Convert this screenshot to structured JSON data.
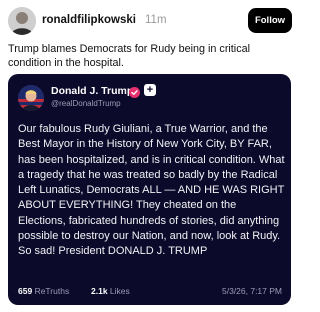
{
  "post": {
    "username": "ronaldfilipkowski",
    "time_ago": "11m",
    "follow_label": "Follow",
    "text": "Trump blames Democrats for Rudy being in critical condition in the hospital."
  },
  "embed": {
    "name": "Donald J. Trump",
    "handle": "@realDonaldTrump",
    "body": "Our fabulous Rudy Giuliani, a True Warrior, and the Best Mayor in the History of New York City, BY FAR, has been hospitalized, and is in critical condition. What a tragedy that he was treated so badly by the Radical Left Lunatics, Democrats ALL — AND HE WAS RIGHT ABOUT EVERYTHING! They cheated on the Elections, fabricated hundreds of stories, did anything possible to destroy our Nation, and now, look at Rudy. So sad! President DONALD J. TRUMP",
    "retruths_count": "659",
    "retruths_label": "ReTruths",
    "likes_count": "2.1k",
    "likes_label": "Likes",
    "date": "5/3/26, 7:17 PM"
  },
  "icons": {
    "verified": "verified-badge-icon",
    "plus": "plus-icon"
  },
  "colors": {
    "embed_background": "#0c0a2b",
    "verified_badge": "#e8306f",
    "follow_button": "#000000"
  }
}
